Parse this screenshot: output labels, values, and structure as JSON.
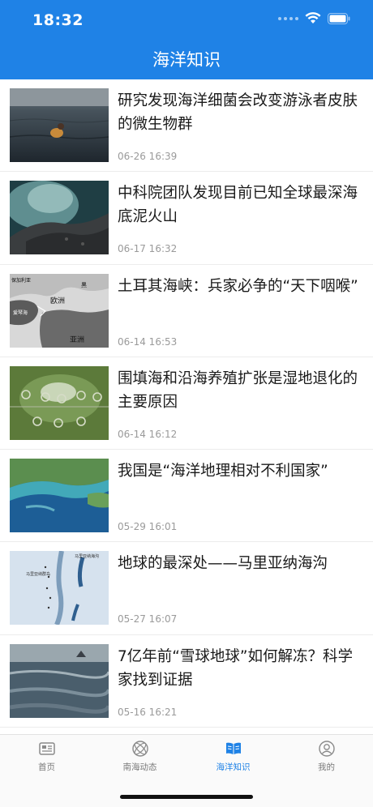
{
  "status_bar": {
    "time": "18:32"
  },
  "header": {
    "title": "海洋知识"
  },
  "articles": [
    {
      "title": "研究发现海洋细菌会改变游泳者皮肤的微生物群",
      "date": "06-26 16:39"
    },
    {
      "title": "中科院团队发现目前已知全球最深海底泥火山",
      "date": "06-17 16:32"
    },
    {
      "title": "土耳其海峡：兵家必争的“天下咽喉”",
      "date": "06-14 16:53"
    },
    {
      "title": "围填海和沿海养殖扩张是湿地退化的主要原因",
      "date": "06-14 16:12"
    },
    {
      "title": "我国是“海洋地理相对不利国家”",
      "date": "05-29 16:01"
    },
    {
      "title": "地球的最深处——马里亚纳海沟",
      "date": "05-27 16:07"
    },
    {
      "title": "7亿年前“雪球地球”如何解冻？科学家找到证据",
      "date": "05-16 16:21"
    }
  ],
  "thumb_labels": {
    "map_europe": "欧洲",
    "map_asia": "亚洲",
    "map_bulgaria": "保加利亚",
    "map_black_sea": "黑",
    "map_aegean": "爱琴海",
    "map_mariana_trench": "马里亚纳海沟",
    "map_mariana_islands": "马里亚纳群岛"
  },
  "tabs": [
    {
      "label": "首页",
      "icon": "newspaper-icon",
      "active": false
    },
    {
      "label": "南海动态",
      "icon": "orbit-icon",
      "active": false
    },
    {
      "label": "海洋知识",
      "icon": "book-icon",
      "active": true
    },
    {
      "label": "我的",
      "icon": "user-icon",
      "active": false
    }
  ],
  "colors": {
    "accent": "#1f82e6",
    "text": "#1a1a1a",
    "muted": "#9a9a9a"
  }
}
